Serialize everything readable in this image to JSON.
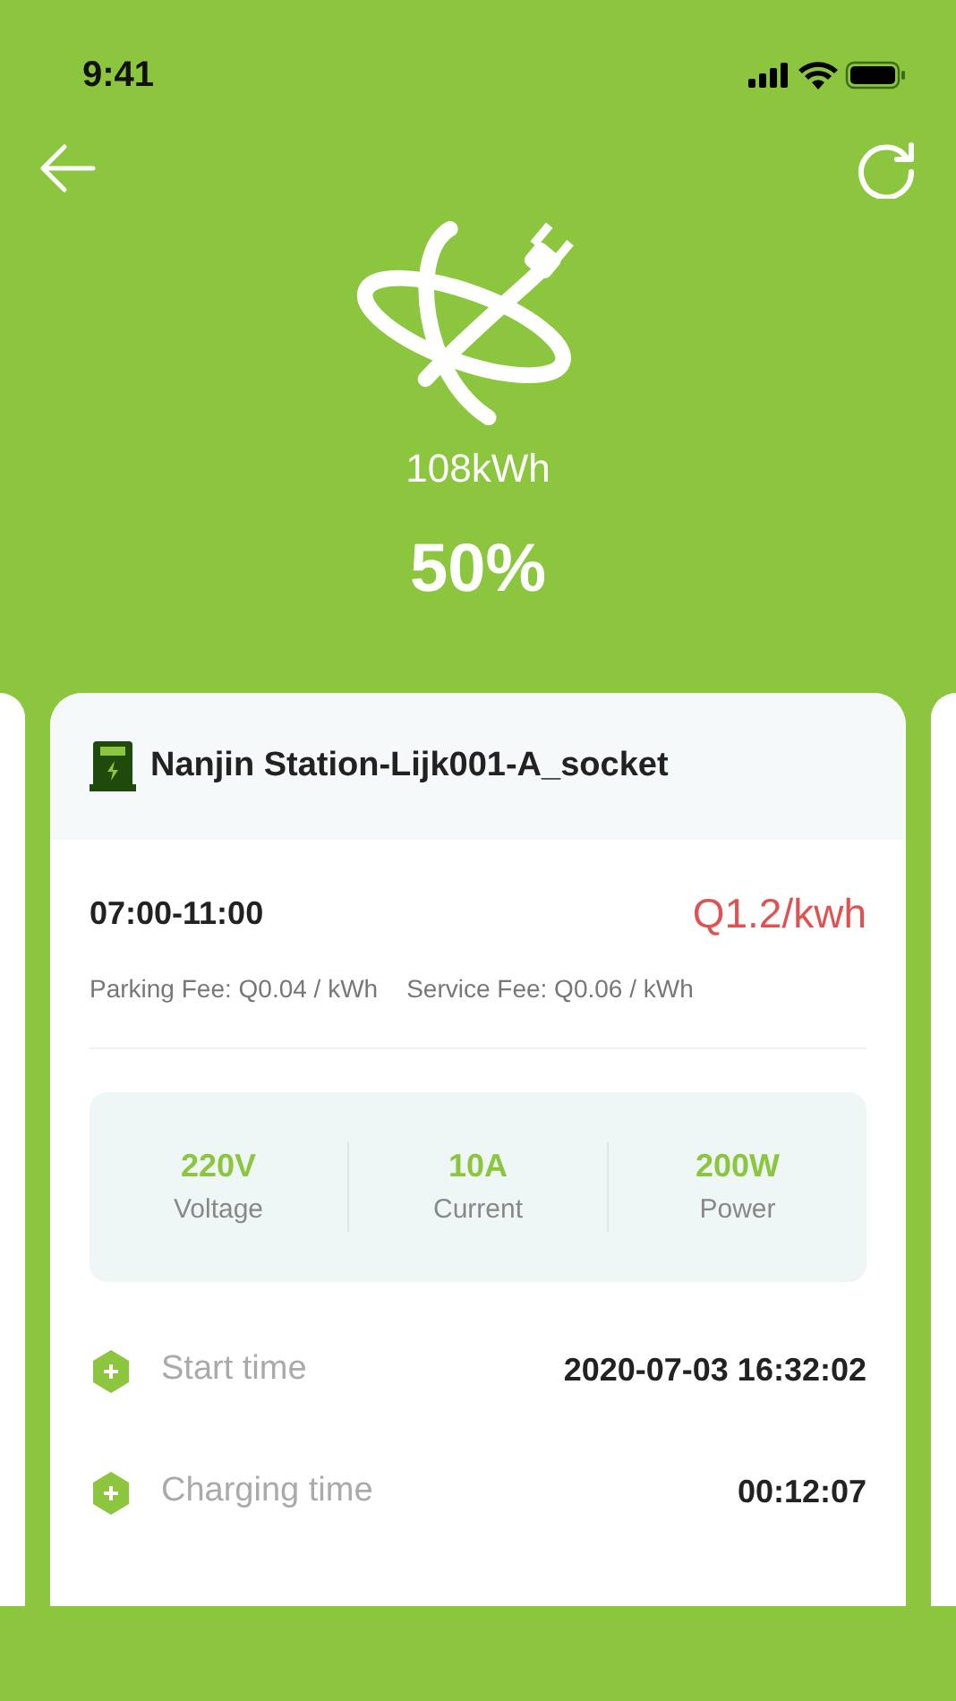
{
  "status_bar": {
    "time": "9:41"
  },
  "summary": {
    "energy": "108kWh",
    "percent": "50%"
  },
  "card": {
    "title": "Nanjin Station-Lijk001-A_socket",
    "time_range": "07:00-11:00",
    "price": "Q1.2/kwh",
    "fees": [
      "Parking Fee: Q0.04 / kWh",
      "Service Fee: Q0.06 / kWh"
    ],
    "metrics": [
      {
        "value": "220V",
        "label": "Voltage"
      },
      {
        "value": "10A",
        "label": "Current"
      },
      {
        "value": "200W",
        "label": "Power"
      }
    ],
    "details": [
      {
        "label": "Start time",
        "value": "2020-07-03 16:32:02"
      },
      {
        "label": "Charging time",
        "value": "00:12:07"
      }
    ]
  }
}
